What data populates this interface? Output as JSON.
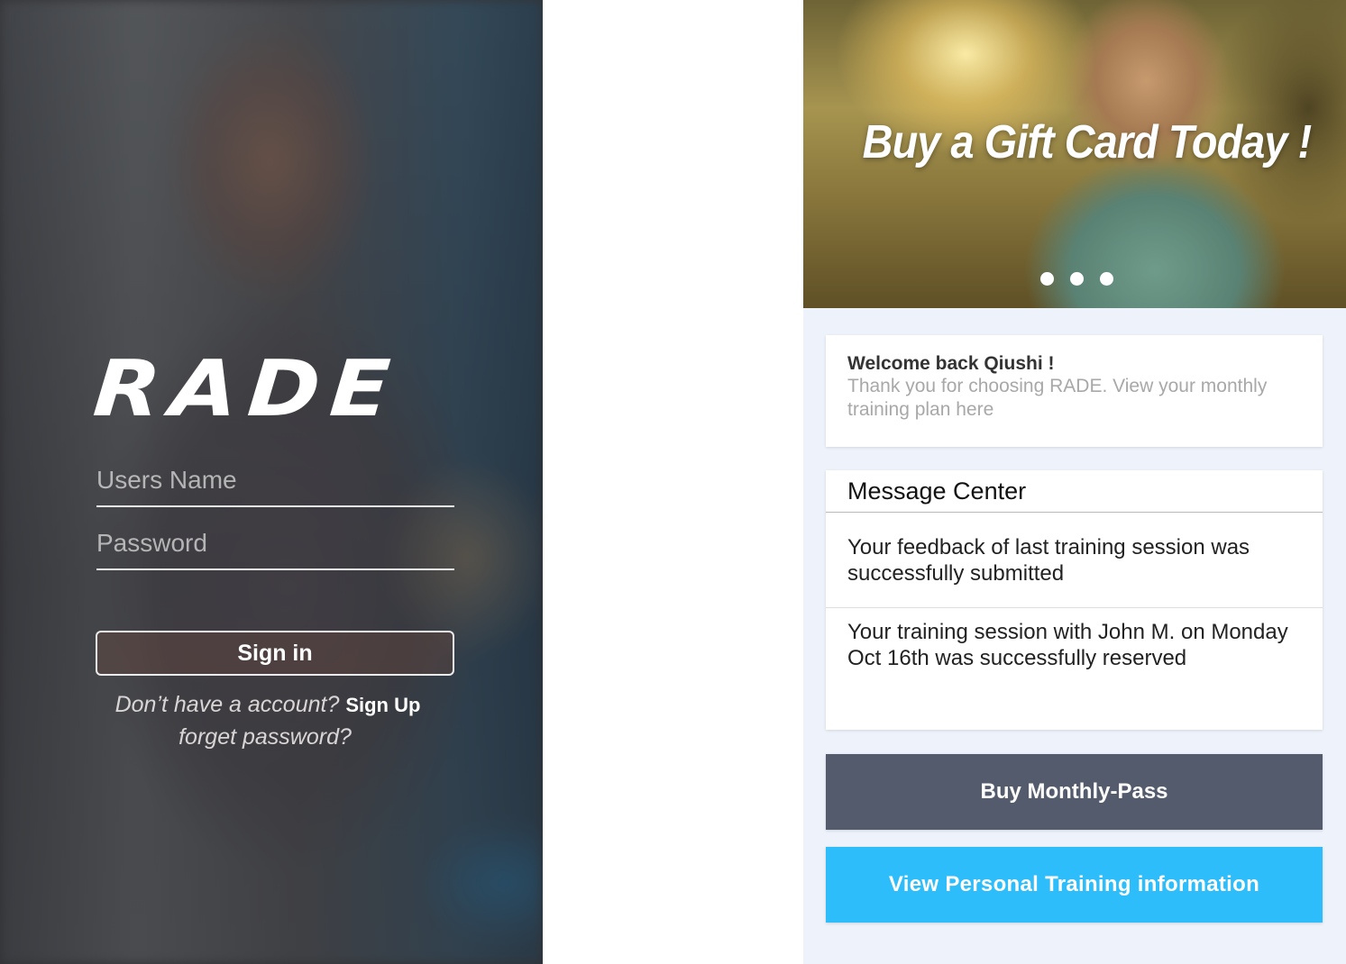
{
  "login": {
    "brand": "RADE",
    "username_placeholder": "Users Name",
    "password_placeholder": "Password",
    "signin_label": "Sign in",
    "no_account_prompt": "Don’t have a account?",
    "signup_label": "Sign Up",
    "forget_password": "forget password?"
  },
  "dashboard": {
    "banner": {
      "title": "Buy a Gift Card Today !",
      "slide_count": 3
    },
    "welcome": {
      "title": "Welcome back Qiushi !",
      "body": "Thank you for choosing RADE. View your monthly training plan here"
    },
    "message_center": {
      "title": "Message Center",
      "messages": [
        "Your feedback of last training session was successfully submitted",
        "Your training session with John M. on Monday Oct 16th was successfully reserved"
      ]
    },
    "buttons": {
      "monthly_pass": "Buy Monthly-Pass",
      "personal_training": "View Personal Training information"
    }
  },
  "colors": {
    "monthly_pass_bg": "#535b6d",
    "personal_training_bg": "#2dbdfb",
    "dashboard_bg": "#eef2fa"
  }
}
